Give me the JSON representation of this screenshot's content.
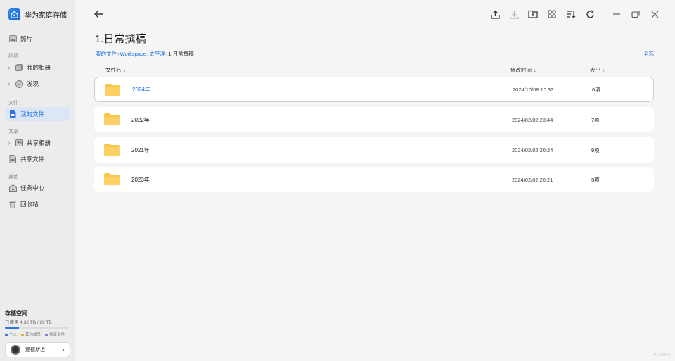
{
  "app": {
    "title": "华为家庭存储",
    "icon": "home-storage-icon"
  },
  "sidebar": {
    "photos": {
      "label": "照片",
      "icon": "photo-icon"
    },
    "sections": {
      "album": "相册",
      "files": "文件",
      "share": "共享",
      "other": "其他"
    },
    "items": {
      "my_album": {
        "label": "我的相册",
        "icon": "album-icon"
      },
      "discover": {
        "label": "发现",
        "icon": "discover-icon"
      },
      "my_files": {
        "label": "我的文件",
        "icon": "file-icon"
      },
      "shared_album": {
        "label": "共享相册",
        "icon": "shared-album-icon"
      },
      "shared_files": {
        "label": "共享文件",
        "icon": "shared-file-icon"
      },
      "task_center": {
        "label": "任务中心",
        "icon": "task-icon"
      },
      "recycle_bin": {
        "label": "回收站",
        "icon": "trash-icon"
      }
    },
    "storage": {
      "title": "存储空间",
      "used_text": "已使用 4.32 TB / 20 TB",
      "used_fraction": 0.216,
      "legend": [
        {
          "label": "个人",
          "color": "#2f74e6"
        },
        {
          "label": "其他成员",
          "color": "#f0a23a"
        },
        {
          "label": "共享文件",
          "color": "#8e6be0"
        }
      ]
    },
    "user": {
      "name": "爱德斯坦"
    }
  },
  "main": {
    "title": "1.日常撰稿",
    "breadcrumb": [
      "我的文件",
      "Workspace",
      "太平洋",
      "1.日常撰稿"
    ],
    "select_all": "全选",
    "columns": {
      "name": "文件名",
      "modified": "修改时间",
      "size": "大小"
    },
    "rows": [
      {
        "name": "2024年",
        "date": "2024/10/08 10:33",
        "count": "6项"
      },
      {
        "name": "2022年",
        "date": "2024/02/02 23:44",
        "count": "7项"
      },
      {
        "name": "2021年",
        "date": "2024/02/02 20:24",
        "count": "9项"
      },
      {
        "name": "2023年",
        "date": "2024/02/02 20:21",
        "count": "5项"
      }
    ]
  },
  "watermark": "PConline",
  "colors": {
    "accent": "#1a6ee6",
    "folder": "#f9c64e"
  }
}
